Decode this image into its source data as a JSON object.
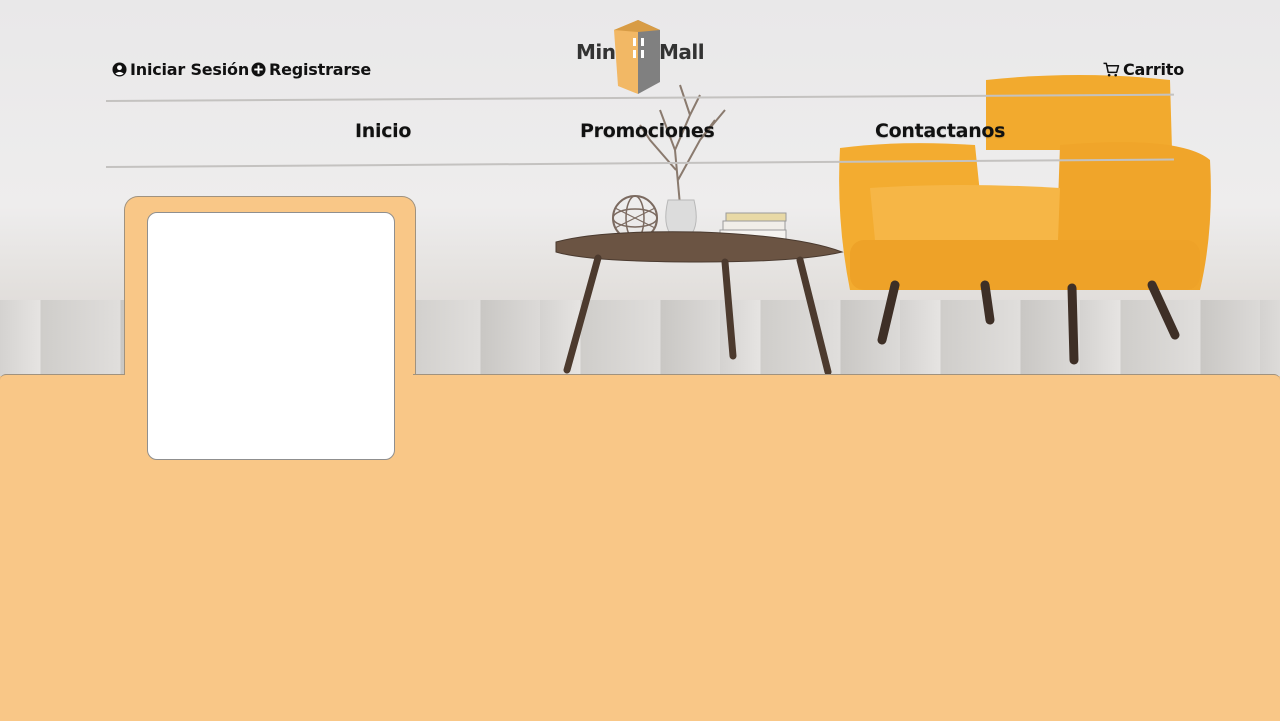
{
  "header": {
    "login_label": "Iniciar Sesión",
    "register_label": "Registrarse",
    "cart_label": "Carrito",
    "logo": {
      "left_text": "Mini",
      "right_text": "Mall"
    }
  },
  "nav": {
    "items": [
      {
        "label": "Inicio"
      },
      {
        "label": "Promociones"
      },
      {
        "label": "Contactanos"
      }
    ]
  },
  "colors": {
    "panel": "#f9c787",
    "logo_gold": "#f2b865",
    "logo_gray": "#808080",
    "chair": "#f2aa2e"
  }
}
